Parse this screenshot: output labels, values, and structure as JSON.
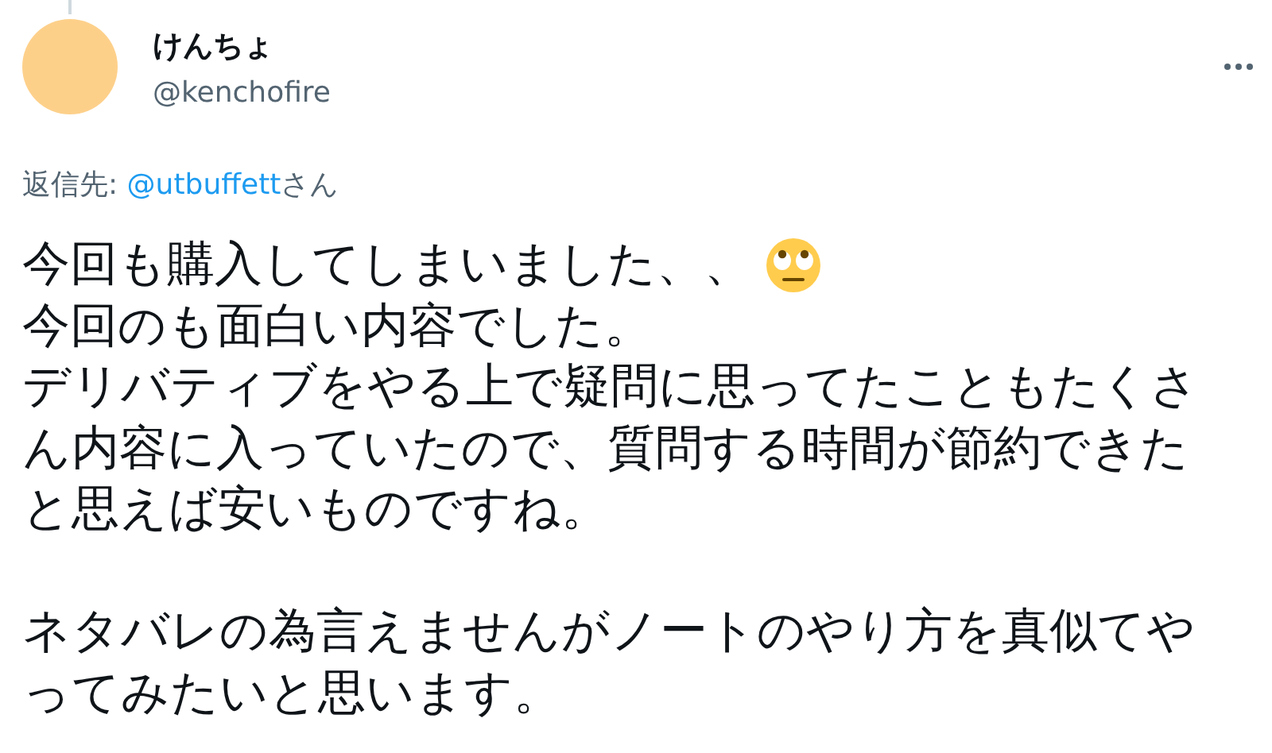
{
  "author": {
    "name": "けんちょ",
    "handle": "@kenchofire"
  },
  "reply_to": {
    "prefix": "返信先: ",
    "mention": "@utbuffett",
    "suffix": "さん"
  },
  "paragraphs": [
    {
      "lines": [
        "今回も購入してしまいました、、",
        "今回のも面白い内容でした。",
        "デリバティブをやる上で疑問に思ってたこともたくさ",
        "ん内容に入っていたので、質問する時間が節約できた",
        "と思えば安いものですね。"
      ],
      "emoji": true
    },
    {
      "lines": [
        "ネタバレの為言えませんがノートのやり方を真似てや",
        "ってみたいと思います。"
      ]
    }
  ]
}
